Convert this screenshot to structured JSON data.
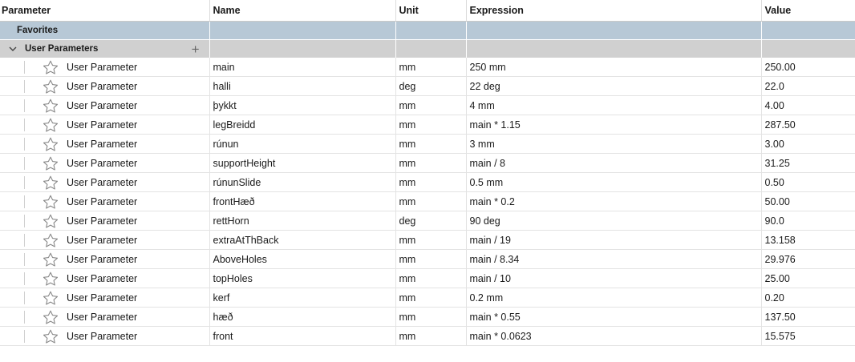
{
  "columns": {
    "parameter": "Parameter",
    "name": "Name",
    "unit": "Unit",
    "expression": "Expression",
    "value": "Value"
  },
  "groups": {
    "favorites": "Favorites",
    "user_parameters": "User Parameters"
  },
  "icons": {
    "favorite": "star-outline-icon",
    "expand": "chevron-down-icon",
    "add": "plus-icon"
  },
  "rows": [
    {
      "type": "User Parameter",
      "name": "main",
      "unit": "mm",
      "expression": "250 mm",
      "value": "250.00"
    },
    {
      "type": "User Parameter",
      "name": "halli",
      "unit": "deg",
      "expression": "22 deg",
      "value": "22.0"
    },
    {
      "type": "User Parameter",
      "name": "þykkt",
      "unit": "mm",
      "expression": "4 mm",
      "value": "4.00"
    },
    {
      "type": "User Parameter",
      "name": "legBreidd",
      "unit": "mm",
      "expression": "main * 1.15",
      "value": "287.50"
    },
    {
      "type": "User Parameter",
      "name": "rúnun",
      "unit": "mm",
      "expression": "3 mm",
      "value": "3.00"
    },
    {
      "type": "User Parameter",
      "name": "supportHeight",
      "unit": "mm",
      "expression": "main / 8",
      "value": "31.25"
    },
    {
      "type": "User Parameter",
      "name": "rúnunSlide",
      "unit": "mm",
      "expression": "0.5 mm",
      "value": "0.50"
    },
    {
      "type": "User Parameter",
      "name": "frontHæð",
      "unit": "mm",
      "expression": "main * 0.2",
      "value": "50.00"
    },
    {
      "type": "User Parameter",
      "name": "rettHorn",
      "unit": "deg",
      "expression": "90 deg",
      "value": "90.0"
    },
    {
      "type": "User Parameter",
      "name": "extraAtThBack",
      "unit": "mm",
      "expression": "main / 19",
      "value": "13.158"
    },
    {
      "type": "User Parameter",
      "name": "AboveHoles",
      "unit": "mm",
      "expression": "main / 8.34",
      "value": "29.976"
    },
    {
      "type": "User Parameter",
      "name": "topHoles",
      "unit": "mm",
      "expression": "main / 10",
      "value": "25.00"
    },
    {
      "type": "User Parameter",
      "name": "kerf",
      "unit": "mm",
      "expression": "0.2 mm",
      "value": "0.20"
    },
    {
      "type": "User Parameter",
      "name": "hæð",
      "unit": "mm",
      "expression": "main * 0.55",
      "value": "137.50"
    },
    {
      "type": "User Parameter",
      "name": "front",
      "unit": "mm",
      "expression": "main * 0.0623",
      "value": "15.575"
    }
  ]
}
